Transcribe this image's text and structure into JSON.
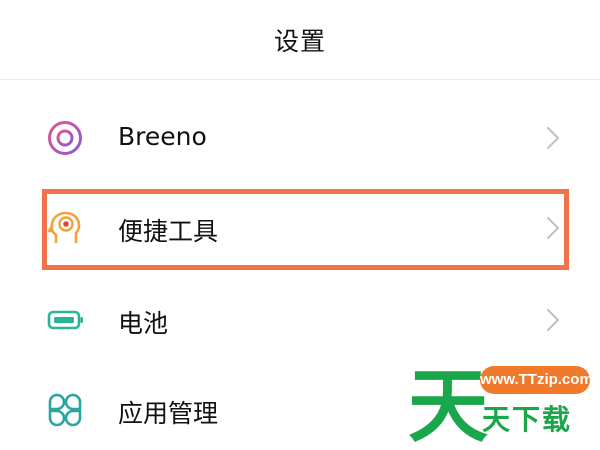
{
  "header": {
    "title": "设置"
  },
  "settings": {
    "items": [
      {
        "label": "Breeno",
        "icon": "breeno-ring-icon"
      },
      {
        "label": "便捷工具",
        "icon": "head-gear-icon"
      },
      {
        "label": "电池",
        "icon": "battery-icon"
      },
      {
        "label": "应用管理",
        "icon": "app-grid-icon"
      }
    ]
  },
  "watermark": {
    "logo_char": "天",
    "url": "www.TTzip.com",
    "text": "天下载"
  },
  "colors": {
    "highlight": "#f0744a",
    "breeno_gradient": [
      "#e2578e",
      "#8a5bd6"
    ],
    "tools_icon": "#f3a23a",
    "battery_icon": "#2ab59a",
    "apps_icon": "#2aa5a0",
    "watermark_green": "#1aa64a",
    "watermark_orange": "#f07a2b"
  }
}
